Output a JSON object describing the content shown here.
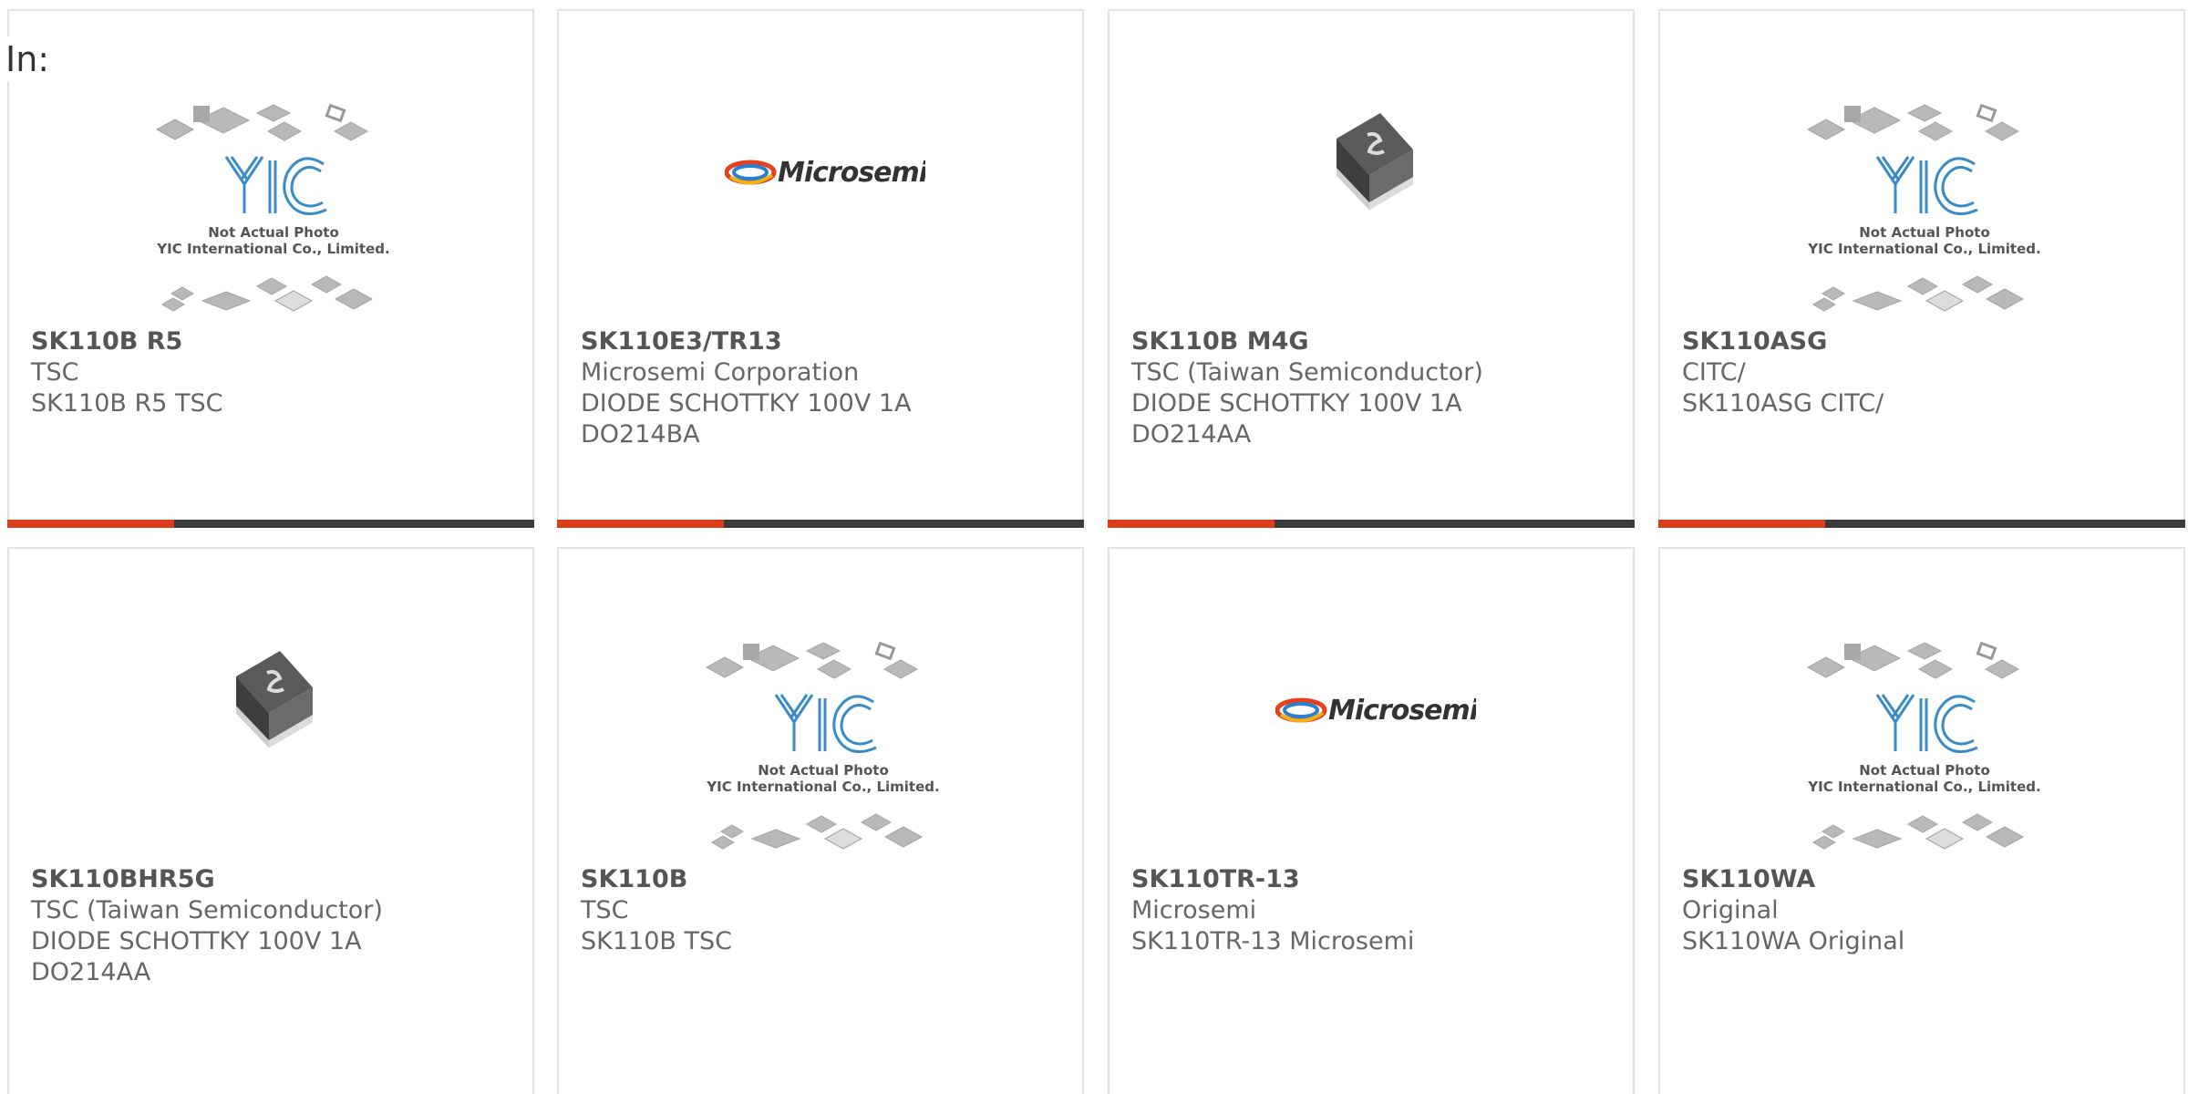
{
  "heading": "In:",
  "colors": {
    "accent": "#dc3d1a",
    "bar": "#3b3b3b",
    "border": "#e3e3e3"
  },
  "placeholder_text": {
    "line1": "Not Actual Photo",
    "line2": "YIC International Co., Limited."
  },
  "brand_text": "Microsemi",
  "cards": [
    {
      "image": "yic-placeholder",
      "part": "SK110B R5",
      "lines": [
        "TSC",
        "SK110B R5 TSC"
      ]
    },
    {
      "image": "microsemi-logo",
      "part": "SK110E3/TR13",
      "lines": [
        "Microsemi Corporation",
        "DIODE SCHOTTKY 100V 1A",
        "DO214BA"
      ]
    },
    {
      "image": "smd-diode",
      "part": "SK110B M4G",
      "lines": [
        "TSC (Taiwan Semiconductor)",
        "DIODE SCHOTTKY 100V 1A",
        "DO214AA"
      ]
    },
    {
      "image": "yic-placeholder",
      "part": "SK110ASG",
      "lines": [
        "CITC/",
        "SK110ASG CITC/"
      ]
    },
    {
      "image": "smd-diode",
      "part": "SK110BHR5G",
      "lines": [
        "TSC (Taiwan Semiconductor)",
        "DIODE SCHOTTKY 100V 1A",
        "DO214AA"
      ]
    },
    {
      "image": "yic-placeholder",
      "part": "SK110B",
      "lines": [
        "TSC",
        "SK110B TSC"
      ]
    },
    {
      "image": "microsemi-logo",
      "part": "SK110TR-13",
      "lines": [
        "Microsemi",
        "SK110TR-13 Microsemi"
      ]
    },
    {
      "image": "yic-placeholder",
      "part": "SK110WA",
      "lines": [
        "Original",
        "SK110WA Original"
      ]
    }
  ]
}
